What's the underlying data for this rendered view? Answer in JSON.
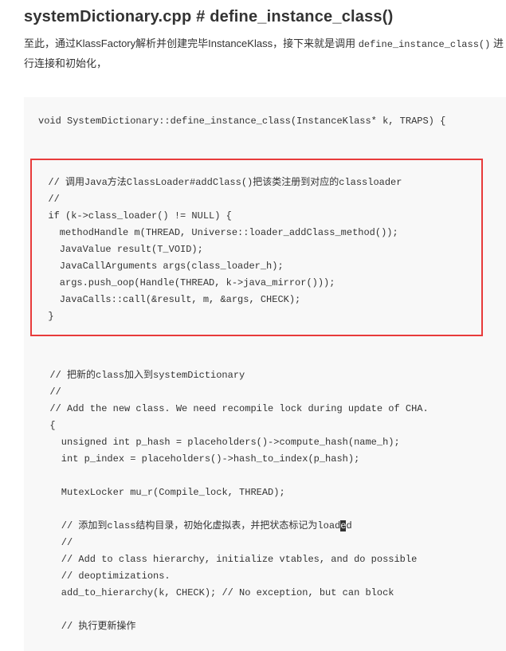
{
  "heading": "systemDictionary.cpp # define_instance_class()",
  "intro": {
    "part1": "至此，通过KlassFactory解析并创建完毕InstanceKlass，接下来就是调用 ",
    "code": "define_instance_class()",
    "part2": " 进行连接和初始化，"
  },
  "code": {
    "sig": "void SystemDictionary::define_instance_class(InstanceKlass* k, TRAPS) {",
    "hl": [
      "  // 调用Java方法ClassLoader#addClass()把该类注册到对应的classloader",
      "  //",
      "  if (k->class_loader() != NULL) {",
      "    methodHandle m(THREAD, Universe::loader_addClass_method());",
      "    JavaValue result(T_VOID);",
      "    JavaCallArguments args(class_loader_h);",
      "    args.push_oop(Handle(THREAD, k->java_mirror()));",
      "    JavaCalls::call(&result, m, &args, CHECK);",
      "  }"
    ],
    "rest_a": [
      "  // 把新的class加入到systemDictionary",
      "  //",
      "  // Add the new class. We need recompile lock during update of CHA.",
      "  {",
      "    unsigned int p_hash = placeholders()->compute_hash(name_h);",
      "    int p_index = placeholders()->hash_to_index(p_hash);",
      "",
      "    MutexLocker mu_r(Compile_lock, THREAD);",
      ""
    ],
    "caret_line_pre": "    // 添加到class结构目录，初始化虚拟表，并把状态标记为load",
    "caret_line_mid": "e",
    "caret_line_post": "d",
    "rest_b": [
      "    //",
      "    // Add to class hierarchy, initialize vtables, and do possible",
      "    // deoptimizations.",
      "    add_to_hierarchy(k, CHECK); // No exception, but can block",
      "",
      "    // 执行更新操作"
    ]
  }
}
